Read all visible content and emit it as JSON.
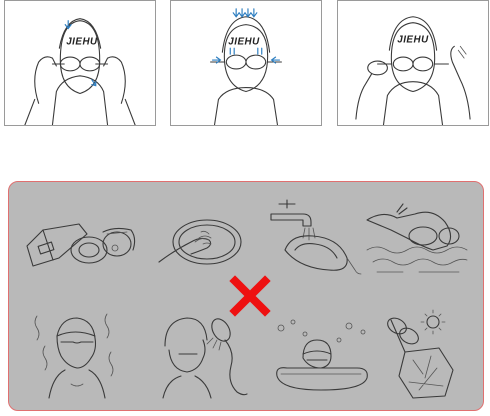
{
  "steps": [
    {
      "brand": "JIEHU",
      "icon": "wear-goggles-step-1"
    },
    {
      "brand": "JIEHU",
      "icon": "press-goggles-step-2"
    },
    {
      "brand": "JIEHU",
      "icon": "adjust-strap-step-3"
    }
  ],
  "warning_panel": {
    "icons": [
      "goggles-in-case-icon",
      "finger-touch-lens-icon",
      "faucet-rinse-icon",
      "goggles-in-water-icon",
      "sauna-heat-icon",
      "shower-icon",
      "hot-bath-icon",
      "sun-exposure-icon"
    ],
    "cross_icon": "red-cross-icon",
    "colors": {
      "background": "#b9b9b9",
      "border": "#e07070",
      "cross": "#ee1111",
      "arrows": "#2f7fc1"
    }
  }
}
